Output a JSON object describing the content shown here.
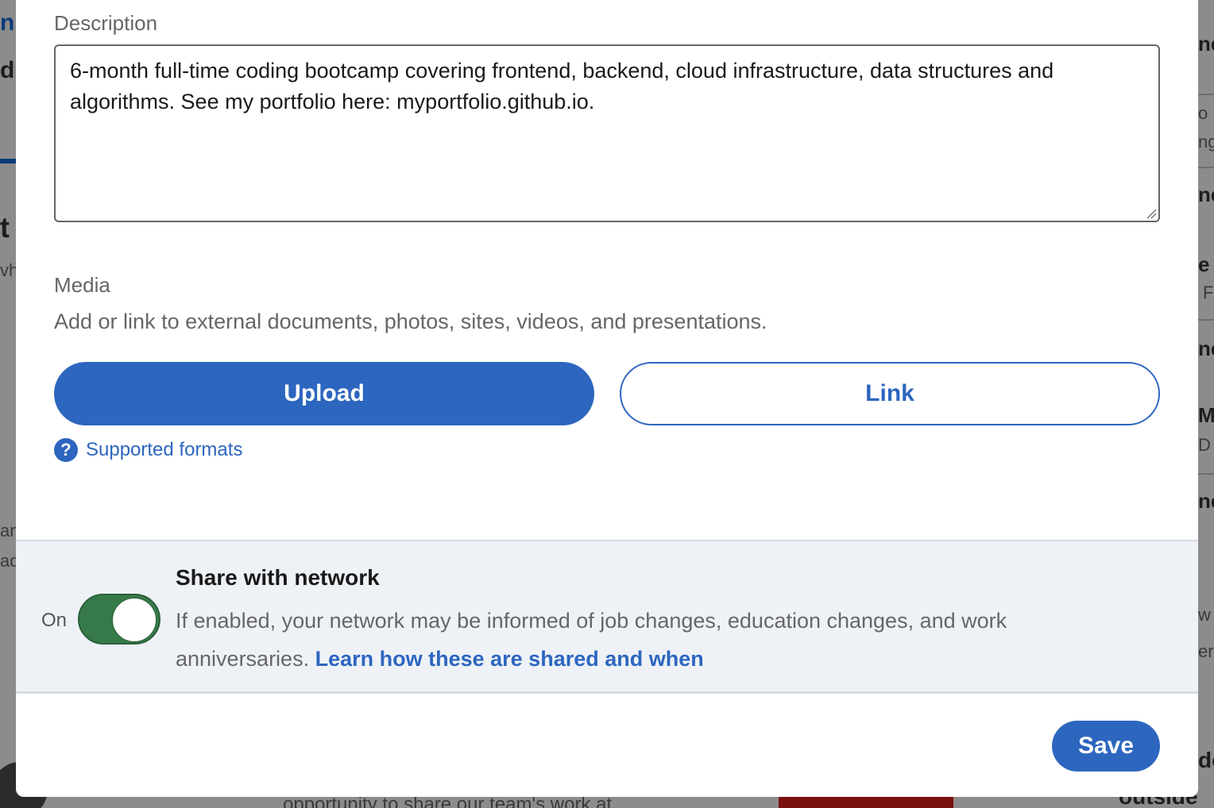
{
  "background": {
    "left_fragments": [
      "n",
      "d",
      "t i",
      "vh",
      "an",
      "ad"
    ],
    "right_fragments": [
      "ne",
      "o :",
      "ng",
      "ne",
      "e",
      "F",
      "ne",
      "M",
      "D",
      "ne",
      "w",
      "er",
      "do",
      "outside"
    ],
    "bottom_text": "opportunity to share our team's work at"
  },
  "description": {
    "label": "Description",
    "value": "6-month full-time coding bootcamp covering frontend, backend, cloud infrastructure, data structures and algorithms. See my portfolio here: myportfolio.github.io."
  },
  "media": {
    "label": "Media",
    "help": "Add or link to external documents, photos, sites, videos, and presentations.",
    "upload_label": "Upload",
    "link_label": "Link",
    "formats_icon": "help-circle-icon",
    "formats_label": "Supported formats"
  },
  "share": {
    "state_label": "On",
    "enabled": true,
    "title": "Share with network",
    "description": "If enabled, your network may be informed of job changes, education changes, and work anniversaries.",
    "learn_link": "Learn how these are shared and when"
  },
  "footer": {
    "save_label": "Save"
  },
  "colors": {
    "accent": "#2d66bf",
    "toggle_on": "#367a4a",
    "panel_bg": "#eef2f7"
  }
}
